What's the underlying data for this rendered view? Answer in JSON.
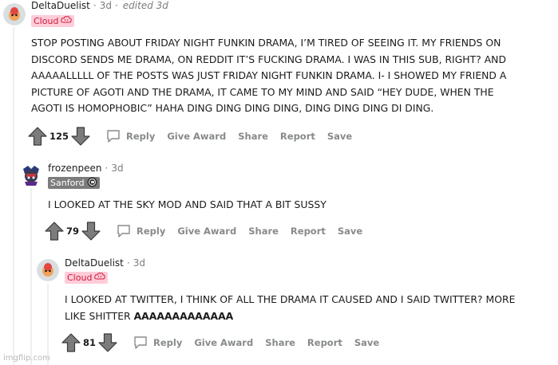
{
  "comments": [
    {
      "author": "DeltaDuelist",
      "time": "3d",
      "edited": "edited 3d",
      "flair_text": "Cloud",
      "flair_icon": "cloud-emoji-icon",
      "body": [
        "STOP POSTING ABOUT FRIDAY NIGHT FUNKIN DRAMA, I’M TIRED OF SEEING IT. MY FRIENDS ON",
        "DISCORD SENDS ME DRAMA, ON REDDIT IT’S FUCKING DRAMA. I WAS IN THIS SUB, RIGHT? AND",
        "AAAAALLLLL OF THE POSTS WAS JUST FRIDAY NIGHT FUNKIN DRAMA. I- I SHOWED MY FRIEND A",
        "PICTURE OF AGOTI AND THE DRAMA, IT CAME TO MY MIND AND SAID “HEY DUDE, WHEN THE",
        "AGOTI IS HOMOPHOBIC” HAHA DING DING DING DING, DING DING DING DI DING."
      ],
      "score": "125"
    },
    {
      "author": "frozenpeen",
      "time": "3d",
      "flair_text": "Sanford",
      "flair_icon": "sanford-emoji-icon",
      "body": [
        "I LOOKED AT THE SKY MOD AND SAID THAT A BIT SUSSY"
      ],
      "score": "79"
    },
    {
      "author": "DeltaDuelist",
      "time": "3d",
      "flair_text": "Cloud",
      "flair_icon": "cloud-emoji-icon",
      "body": [
        "I LOOKED AT TWITTER, I THINK OF ALL THE DRAMA IT CAUSED AND I SAID TWITTER? MORE"
      ],
      "body_last_plain": "LIKE SHITTER ",
      "body_last_bold": "AAAAAAAAAAAAA",
      "score": "81"
    }
  ],
  "actions": {
    "reply": "Reply",
    "give_award": "Give Award",
    "share": "Share",
    "report": "Report",
    "save": "Save"
  },
  "separator": "·",
  "watermark": "imgflip.com",
  "colors": {
    "meta": "#878a8c",
    "flair_pink_bg": "#ffccd9",
    "flair_gray_bg": "#7c7c7c",
    "thread_line": "#edeff1"
  }
}
